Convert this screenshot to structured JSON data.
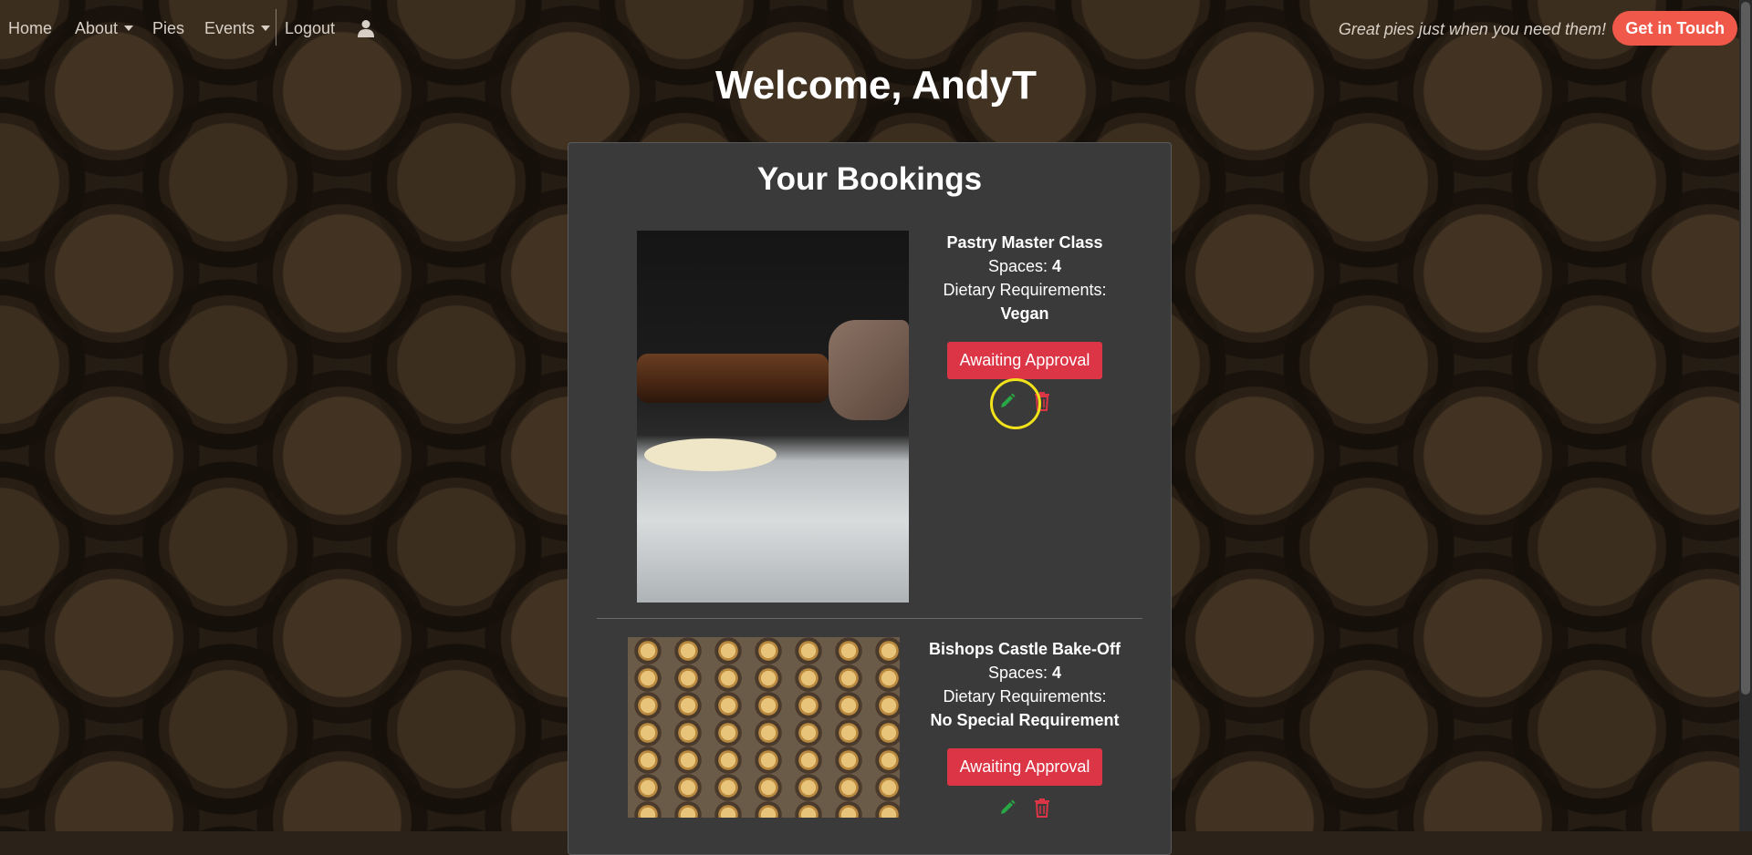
{
  "nav": {
    "home": "Home",
    "about": "About",
    "pies": "Pies",
    "events": "Events",
    "logout": "Logout"
  },
  "tagline": "Great pies just when you need them!",
  "cta_label": "Get in Touch",
  "welcome": "Welcome, AndyT",
  "bookings": {
    "title": "Your Bookings",
    "spaces_label": "Spaces:",
    "dietary_label": "Dietary Requirements:",
    "items": [
      {
        "event": "Pastry Master Class",
        "spaces": "4",
        "dietary": "Vegan",
        "status": "Awaiting Approval"
      },
      {
        "event": "Bishops Castle Bake-Off",
        "spaces": "4",
        "dietary": "No Special Requirement",
        "status": "Awaiting Approval"
      }
    ]
  },
  "colors": {
    "accent": "#f0594a",
    "status_pending": "#dc3545",
    "edit_icon": "#28a745",
    "delete_icon": "#dc3545",
    "highlight_ring": "#f2e21a"
  }
}
